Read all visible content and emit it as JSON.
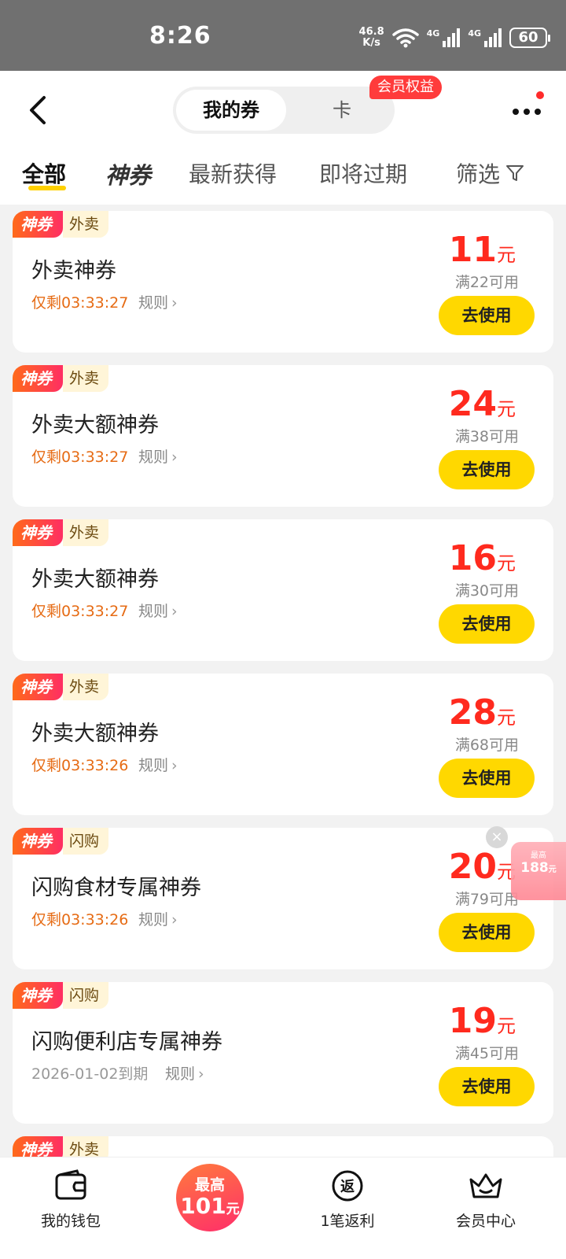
{
  "status_bar": {
    "time": "8:26",
    "net_speed_top": "46.8",
    "net_speed_bottom": "K/s",
    "signal1_label": "4G",
    "signal2_label": "4G",
    "battery": "60"
  },
  "header": {
    "segment_active": "我的券",
    "segment_other": "卡",
    "vip_badge": "会员权益",
    "icons": {
      "back": "back-icon",
      "more": "more-icon"
    }
  },
  "tabs": [
    {
      "label": "全部",
      "active": true
    },
    {
      "label": "神券",
      "active": false
    },
    {
      "label": "最新获得",
      "active": false
    },
    {
      "label": "即将过期",
      "active": false
    },
    {
      "label": "筛选",
      "active": false
    }
  ],
  "coupons": [
    {
      "tag": "神券",
      "category": "外卖",
      "title": "外卖神券",
      "expire": "仅剩03:33:27",
      "rule": "规则",
      "amount": "11",
      "unit": "元",
      "condition": "满22可用",
      "button": "去使用"
    },
    {
      "tag": "神券",
      "category": "外卖",
      "title": "外卖大额神券",
      "expire": "仅剩03:33:27",
      "rule": "规则",
      "amount": "24",
      "unit": "元",
      "condition": "满38可用",
      "button": "去使用"
    },
    {
      "tag": "神券",
      "category": "外卖",
      "title": "外卖大额神券",
      "expire": "仅剩03:33:27",
      "rule": "规则",
      "amount": "16",
      "unit": "元",
      "condition": "满30可用",
      "button": "去使用"
    },
    {
      "tag": "神券",
      "category": "外卖",
      "title": "外卖大额神券",
      "expire": "仅剩03:33:26",
      "rule": "规则",
      "amount": "28",
      "unit": "元",
      "condition": "满68可用",
      "button": "去使用"
    },
    {
      "tag": "神券",
      "category": "闪购",
      "title": "闪购食材专属神券",
      "expire": "仅剩03:33:26",
      "rule": "规则",
      "amount": "20",
      "unit": "元",
      "condition": "满79可用",
      "button": "去使用"
    },
    {
      "tag": "神券",
      "category": "闪购",
      "title": "闪购便利店专属神券",
      "expire": "2026-01-02到期",
      "rule": "规则",
      "amount": "19",
      "unit": "元",
      "condition": "满45可用",
      "button": "去使用"
    },
    {
      "tag": "神券",
      "category": "外卖"
    }
  ],
  "float_ad": {
    "top": "最高",
    "big": "188",
    "unit": "元"
  },
  "bottom_nav": {
    "wallet": "我的钱包",
    "promo_top": "最高",
    "promo_amount": "101",
    "promo_unit": "元",
    "rebate": "1笔返利",
    "rebate_icon_text": "返",
    "member": "会员中心"
  },
  "colors": {
    "accent_yellow": "#ffd800",
    "price_red": "#ff2a1e",
    "expire_orange": "#e66b14"
  }
}
